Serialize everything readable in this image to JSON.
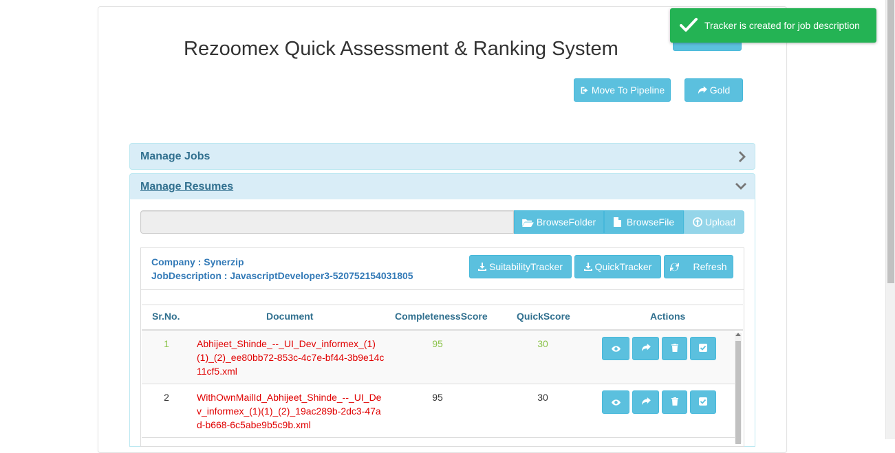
{
  "app": {
    "title": "Rezoomex Quick Assessment & Ranking System"
  },
  "actions": {
    "move_to_pipeline": "Move To Pipeline",
    "gold": "Gold"
  },
  "toast": {
    "message": "Tracker is created for job description",
    "color": "#24b354"
  },
  "panels": {
    "manage_jobs": "Manage Jobs",
    "manage_resumes": "Manage Resumes"
  },
  "upload": {
    "browse_folder": "BrowseFolder",
    "browse_file": "BrowseFile",
    "upload": "Upload"
  },
  "job_info": {
    "company": "Company : Synerzip",
    "job_description": "JobDescription : JavascriptDeveloper3-520752154031805"
  },
  "tracker_buttons": {
    "suitability": "SuitabilityTracker",
    "quick": "QuickTracker",
    "refresh": "Refresh"
  },
  "table": {
    "columns": [
      "Sr.No.",
      "Document",
      "CompletenessScore",
      "QuickScore",
      "Actions"
    ],
    "rows": [
      {
        "sr": "1",
        "document": "Abhijeet_Shinde_--_UI_Dev_informex_(1)(1)_(2)_ee80bb72-853c-4c7e-bf44-3b9e14c11cf5.xml",
        "completeness": "95",
        "quick": "30",
        "highlight": true
      },
      {
        "sr": "2",
        "document": "WithOwnMailId_Abhijeet_Shinde_--_UI_Dev_informex_(1)(1)_(2)_19ac289b-2dc3-47ad-b668-6c5abe9b5c9b.xml",
        "completeness": "95",
        "quick": "30",
        "highlight": false
      }
    ]
  },
  "colors": {
    "info_button": "#5bc0de",
    "panel_heading_bg": "#d9edf7",
    "panel_heading_text": "#31708f",
    "document_text": "#e00000",
    "highlight_score": "#8bc34a"
  },
  "icons": {
    "pipeline": "sign-out-icon",
    "gold": "share-icon",
    "folder": "folder-open-icon",
    "file": "file-icon",
    "upload": "upload-circle-icon",
    "download": "download-icon",
    "refresh": "refresh-icon",
    "view": "eye-icon",
    "share": "share-icon",
    "delete": "trash-icon",
    "check": "check-square-icon",
    "toast": "check-icon"
  }
}
